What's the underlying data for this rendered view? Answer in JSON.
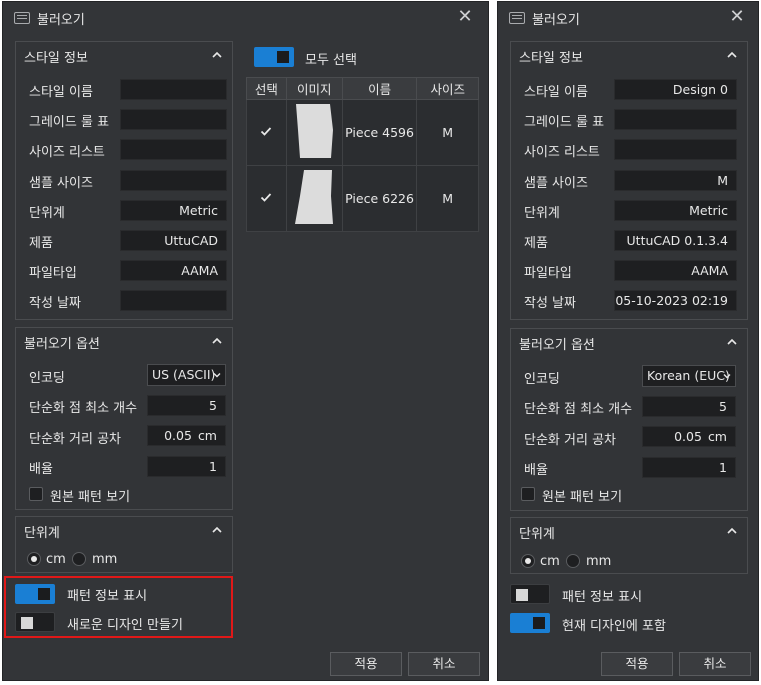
{
  "left": {
    "title": "불러오기",
    "style_info": {
      "header": "스타일 정보",
      "rows": [
        {
          "label": "스타일 이름",
          "value": ""
        },
        {
          "label": "그레이드 룰 표",
          "value": ""
        },
        {
          "label": "사이즈 리스트",
          "value": ""
        },
        {
          "label": "샘플 사이즈",
          "value": ""
        },
        {
          "label": "단위계",
          "value": "Metric"
        },
        {
          "label": "제품",
          "value": "UttuCAD"
        },
        {
          "label": "파일타입",
          "value": "AAMA"
        },
        {
          "label": "작성 날짜",
          "value": ""
        }
      ]
    },
    "import_options": {
      "header": "불러오기 옵션",
      "encoding_label": "인코딩",
      "encoding_value": "US (ASCII)",
      "min_points_label": "단순화 점 최소 개수",
      "min_points_value": "5",
      "tolerance_label": "단순화 거리 공차",
      "tolerance_value": "0.05",
      "tolerance_unit": "cm",
      "scale_label": "배율",
      "scale_value": "1",
      "show_original_label": "원본 패턴 보기"
    },
    "units": {
      "header": "단위계",
      "cm": "cm",
      "mm": "mm"
    },
    "toggle1": {
      "label": "패턴 정보 표시",
      "on": true
    },
    "toggle2": {
      "label": "새로운 디자인 만들기",
      "on": false
    },
    "apply": "적용",
    "cancel": "취소",
    "select_all": "모두 선택",
    "table": {
      "headers": [
        "선택",
        "이미지",
        "이름",
        "사이즈"
      ],
      "rows": [
        {
          "checked": true,
          "name": "Piece 4596",
          "size": "M"
        },
        {
          "checked": true,
          "name": "Piece 6226",
          "size": "M"
        }
      ]
    }
  },
  "right": {
    "title": "불러오기",
    "style_info": {
      "header": "스타일 정보",
      "rows": [
        {
          "label": "스타일 이름",
          "value": "Design 0"
        },
        {
          "label": "그레이드 룰 표",
          "value": ""
        },
        {
          "label": "사이즈 리스트",
          "value": ""
        },
        {
          "label": "샘플 사이즈",
          "value": "M"
        },
        {
          "label": "단위계",
          "value": "Metric"
        },
        {
          "label": "제품",
          "value": "UttuCAD 0.1.3.4"
        },
        {
          "label": "파일타입",
          "value": "AAMA"
        },
        {
          "label": "작성 날짜",
          "value": "05-10-2023 02:19"
        }
      ]
    },
    "import_options": {
      "header": "불러오기 옵션",
      "encoding_label": "인코딩",
      "encoding_value": "Korean (EUC)",
      "min_points_label": "단순화 점 최소 개수",
      "min_points_value": "5",
      "tolerance_label": "단순화 거리 공차",
      "tolerance_value": "0.05",
      "tolerance_unit": "cm",
      "scale_label": "배율",
      "scale_value": "1",
      "show_original_label": "원본 패턴 보기"
    },
    "units": {
      "header": "단위계",
      "cm": "cm",
      "mm": "mm"
    },
    "toggle1": {
      "label": "패턴 정보 표시",
      "on": false
    },
    "toggle2": {
      "label": "현재 디자인에 포함",
      "on": true
    },
    "apply": "적용",
    "cancel": "취소"
  },
  "colors": {
    "accent": "#1a7fd4",
    "highlight": "#e01818",
    "background": "#333538"
  }
}
